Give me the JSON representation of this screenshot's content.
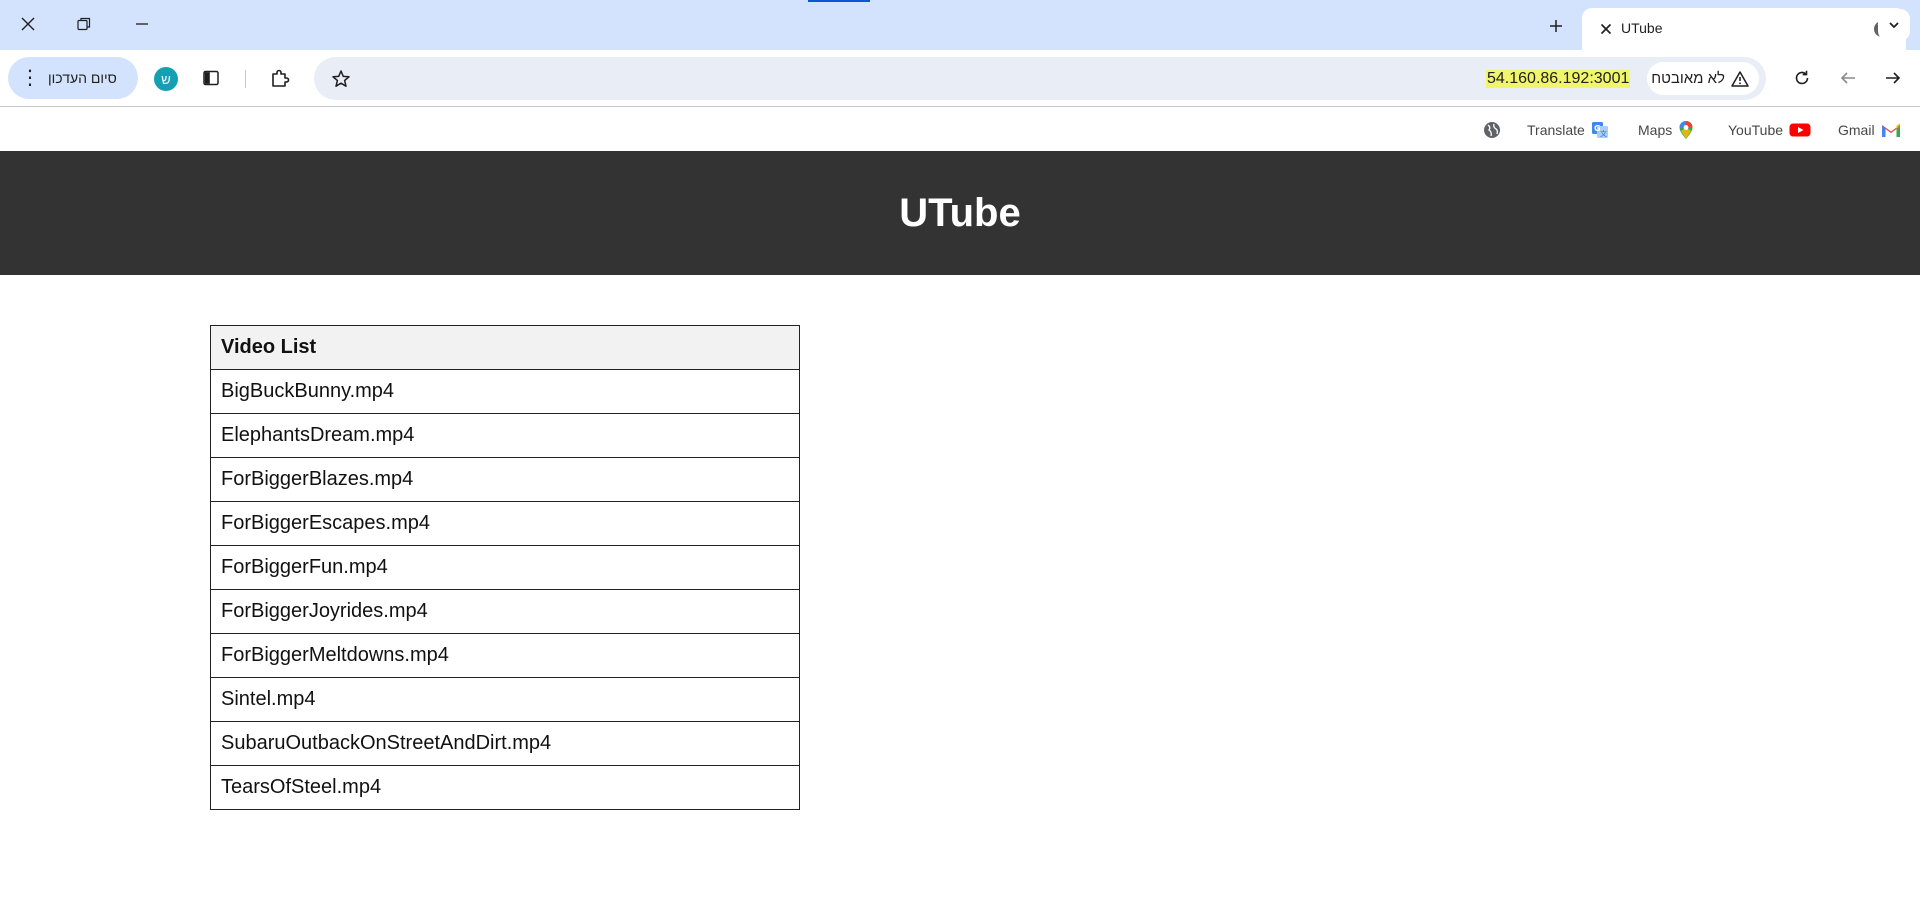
{
  "browser": {
    "tab": {
      "title": "UTube"
    },
    "toolbar": {
      "update_button": "סיום העדכון",
      "avatar_letter": "ש",
      "url": "54.160.86.192:3001",
      "security_label": "לא מאובטח"
    },
    "bookmarks": [
      {
        "label": "Gmail",
        "icon": "gmail-icon"
      },
      {
        "label": "YouTube",
        "icon": "youtube-icon"
      },
      {
        "label": "Maps",
        "icon": "maps-icon"
      },
      {
        "label": "Translate",
        "icon": "translate-icon"
      }
    ]
  },
  "page": {
    "title": "UTube",
    "table": {
      "header": "Video List",
      "rows": [
        "BigBuckBunny.mp4",
        "ElephantsDream.mp4",
        "ForBiggerBlazes.mp4",
        "ForBiggerEscapes.mp4",
        "ForBiggerFun.mp4",
        "ForBiggerJoyrides.mp4",
        "ForBiggerMeltdowns.mp4",
        "Sintel.mp4",
        "SubaruOutbackOnStreetAndDirt.mp4",
        "TearsOfSteel.mp4"
      ]
    }
  },
  "colors": {
    "tabstrip": "#d3e3fd",
    "header_bg": "#333333",
    "url_highlight": "#f1f56a",
    "avatar": "#12a0b2"
  }
}
